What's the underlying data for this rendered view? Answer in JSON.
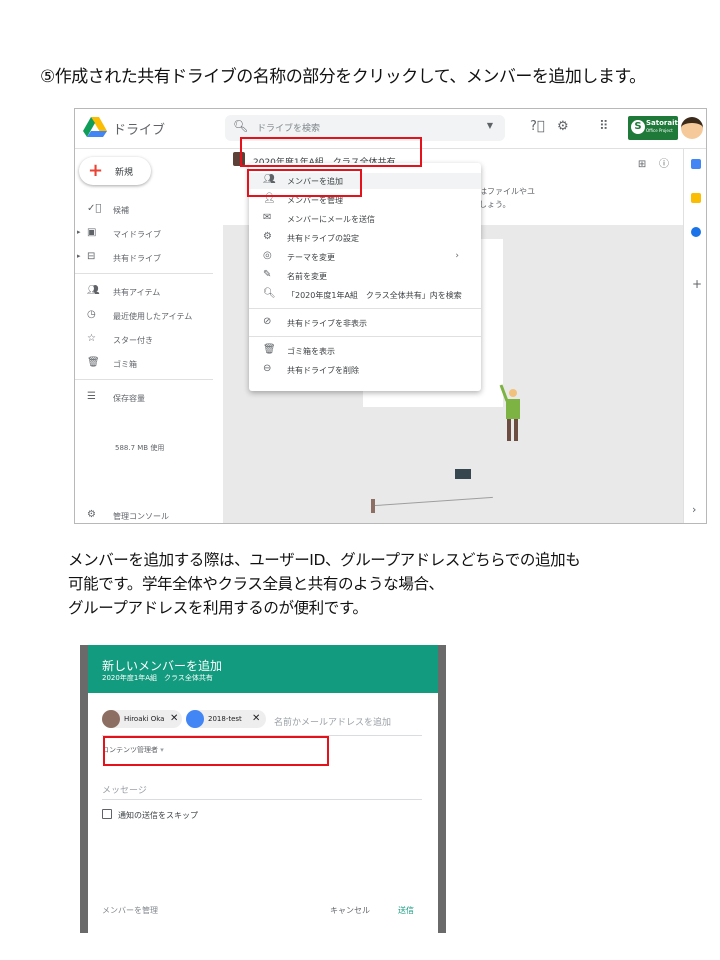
{
  "heading": "⑤作成された共有ドライブの名称の部分をクリックして、メンバーを追加します。",
  "drive": {
    "logo_text": "ドライブ",
    "search_placeholder": "ドライブを検索",
    "brand_name": "Satoraite",
    "brand_sub": "Office Project",
    "new_button": "新規",
    "nav": [
      {
        "icon": "check-circle-icon",
        "label": "候補"
      },
      {
        "icon": "my-drive-icon",
        "label": "マイドライブ"
      },
      {
        "icon": "shared-drives-icon",
        "label": "共有ドライブ"
      },
      {
        "icon": "shared-with-me-icon",
        "label": "共有アイテム"
      },
      {
        "icon": "clock-icon",
        "label": "最近使用したアイテム"
      },
      {
        "icon": "star-icon",
        "label": "スター付き"
      },
      {
        "icon": "trash-icon",
        "label": "ゴミ箱"
      },
      {
        "icon": "storage-icon",
        "label": "保存容量"
      }
    ],
    "storage_used": "588.7 MB 使用",
    "admin_console": "管理コンソール",
    "drive_title": "2020年度1年A組　クラス全体共有",
    "empty_line1": "はファイルやユ",
    "empty_line2": "しょう。",
    "menu": [
      {
        "icon": "add-member-icon",
        "label": "メンバーを追加"
      },
      {
        "icon": "manage-members-icon",
        "label": "メンバーを管理"
      },
      {
        "icon": "mail-icon",
        "label": "メンバーにメールを送信"
      },
      {
        "icon": "settings-icon",
        "label": "共有ドライブの設定"
      },
      {
        "icon": "palette-icon",
        "label": "テーマを変更"
      },
      {
        "icon": "pencil-icon",
        "label": "名前を変更"
      },
      {
        "icon": "search-icon",
        "label": "「2020年度1年A組　クラス全体共有」内を検索"
      },
      {
        "icon": "hide-icon",
        "label": "共有ドライブを非表示"
      },
      {
        "icon": "trash-icon",
        "label": "ゴミ箱を表示"
      },
      {
        "icon": "minus-circle-icon",
        "label": "共有ドライブを削除"
      }
    ]
  },
  "body_text": {
    "line1": "メンバーを追加する際は、ユーザーID、グループアドレスどちらでの追加も",
    "line2": "可能です。学年全体やクラス全員と共有のような場合、",
    "line3": "グループアドレスを利用するのが便利です。"
  },
  "dialog": {
    "title": "新しいメンバーを追加",
    "subtitle": "2020年度1年A組　クラス全体共有",
    "chip1": "Hiroaki Oka",
    "chip2": "2018-test",
    "placeholder": "名前かメールアドレスを追加",
    "role": "コンテンツ管理者",
    "message_placeholder": "メッセージ",
    "skip_notification": "通知の送信をスキップ",
    "manage_members": "メンバーを管理",
    "cancel": "キャンセル",
    "send": "送信"
  },
  "colors": {
    "highlight_red": "#e5121b",
    "dialog_header": "#139b7f"
  }
}
